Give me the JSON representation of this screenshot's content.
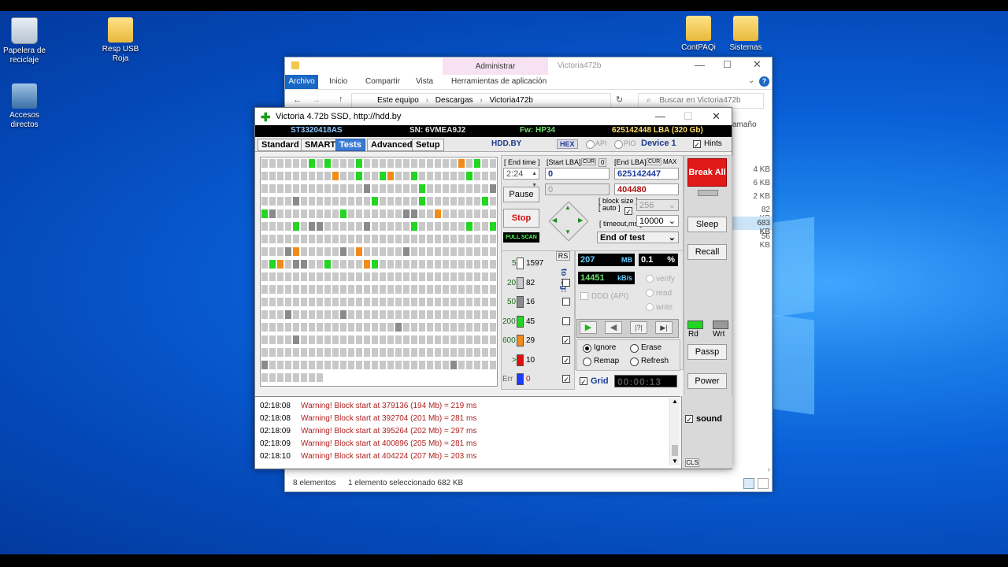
{
  "desktop": {
    "icons": [
      {
        "label": "Papelera de reciclaje"
      },
      {
        "label": "Resp USB Roja"
      },
      {
        "label": "Accesos directos"
      },
      {
        "label": "ContPAQi"
      },
      {
        "label": "Sistemas"
      }
    ]
  },
  "explorer": {
    "title": "Victoria472b",
    "context_tab": "Administrar",
    "ribbon": {
      "archivo": "Archivo",
      "inicio": "Inicio",
      "compartir": "Compartir",
      "vista": "Vista",
      "herramientas": "Herramientas de aplicación"
    },
    "breadcrumb": [
      "Este equipo",
      "Descargas",
      "Victoria472b"
    ],
    "search_placeholder": "Buscar en Victoria472b",
    "column_header": "amaño",
    "sizes": [
      "4 KB",
      "6 KB",
      "2 KB",
      "82 KB",
      "683 KB",
      "56 KB"
    ],
    "status_count": "8 elementos",
    "status_selected": "1 elemento seleccionado  682 KB"
  },
  "victoria": {
    "title": "Victoria 4.72b SSD, http://hdd.by",
    "info": {
      "model": "ST3320418AS",
      "serial": "SN: 6VMEA9J2",
      "firmware": "Fw: HP34",
      "lba": "625142448 LBA (320 Gb)"
    },
    "tabs": [
      "Standard",
      "SMART",
      "Tests",
      "Advanced",
      "Setup"
    ],
    "hdd_by": "HDD.BY",
    "hex": "HEX",
    "api": "API",
    "pio": "PIO",
    "device": "Device 1",
    "hints": "Hints",
    "end_time_label": "[ End time ]",
    "end_time": "2:24",
    "start_lba_label": "[Start LBA]",
    "cur_label": "CUR",
    "cur_value": "0",
    "start_lba": "0",
    "start_lba_cur": "0",
    "end_lba_label": "[End LBA]",
    "max_label": "MAX",
    "end_lba": "625142447",
    "end_lba_cur": "404480",
    "pause": "Pause",
    "stop": "Stop",
    "full_scan": "FULL SCAN",
    "block_size_label": "[ block size ]",
    "auto_label": "[ auto ]",
    "block_size": "256",
    "timeout_label": "[ timeout,ms ]",
    "timeout": "10000",
    "end_of_test": "End of test",
    "break_all": "Break All",
    "sleep": "Sleep",
    "recall": "Recall",
    "rd": "Rd",
    "wrt": "Wrt",
    "passp": "Passp",
    "power": "Power",
    "rs": "RS",
    "to_log": "to log:",
    "stats": [
      {
        "label": "5",
        "count": "1597"
      },
      {
        "label": "20",
        "count": "82"
      },
      {
        "label": "50",
        "count": "16"
      },
      {
        "label": "200",
        "count": "45"
      },
      {
        "label": "600",
        "count": "29"
      },
      {
        "label": ">",
        "count": "10"
      },
      {
        "label": "Err",
        "count": "0"
      }
    ],
    "mb": "207",
    "mb_unit": "MB",
    "percent": "0.1",
    "percent_unit": "%",
    "speed": "14451",
    "speed_unit": "kB/s",
    "verify": "verify",
    "read": "read",
    "write": "write",
    "ddd": "DDD (API)",
    "ignore": "Ignore",
    "erase": "Erase",
    "remap": "Remap",
    "refresh": "Refresh",
    "grid": "Grid",
    "timer": "00:00:13",
    "sound": "sound",
    "cls": "CLS",
    "log": [
      {
        "time": "02:18:08",
        "msg": "Warning! Block start at 379136 (194 Mb)  = 219 ms"
      },
      {
        "time": "02:18:08",
        "msg": "Warning! Block start at 392704 (201 Mb)  = 281 ms"
      },
      {
        "time": "02:18:09",
        "msg": "Warning! Block start at 395264 (202 Mb)  = 297 ms"
      },
      {
        "time": "02:18:09",
        "msg": "Warning! Block start at 400896 (205 Mb)  = 281 ms"
      },
      {
        "time": "02:18:10",
        "msg": "Warning! Block start at 404224 (207 Mb)  = 203 ms"
      }
    ],
    "colors": {
      "gray": "#c8c8c8",
      "darkgray": "#8a8a8a",
      "green": "#22d622",
      "orange": "#f08c1a",
      "red": "#e01010",
      "blue": "#1a3cff"
    }
  }
}
